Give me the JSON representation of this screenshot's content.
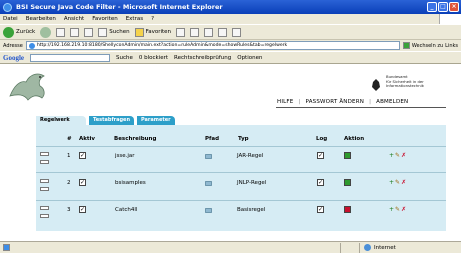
{
  "window": {
    "title": "BSI Secure Java Code Filter - Microsoft Internet Explorer"
  },
  "menu": [
    "Datei",
    "Bearbeiten",
    "Ansicht",
    "Favoriten",
    "Extras",
    "?"
  ],
  "toolbar": {
    "back": "Zurück",
    "search": "Suchen",
    "favorites": "Favoriten"
  },
  "address": {
    "label": "Adresse",
    "url": "http://192.168.219.10:8180/ShellyconAdmin/main.ext?action=ruleAdmin&mode=showRules&tab=regelwerk",
    "go": "Wechseln zu",
    "links": "Links"
  },
  "google": {
    "logo": "Google",
    "search": "Suche",
    "blocked": "0 blockiert",
    "spell": "Rechtschreibprüfung",
    "options": "Optionen"
  },
  "header": {
    "nav": [
      "HILFE",
      "PASSWORT ÄNDERN",
      "ABMELDEN"
    ],
    "bsi_lines": [
      "Bundesamt",
      "für Sicherheit in der",
      "Informationstechnik"
    ]
  },
  "tabs": [
    "Regelwerk",
    "Testabfragen",
    "Parameter"
  ],
  "table": {
    "headers": {
      "num": "#",
      "active": "Aktiv",
      "description": "Beschreibung",
      "path": "Pfad",
      "type": "Typ",
      "log": "Log",
      "action": "Aktion"
    },
    "rows": [
      {
        "num": "1",
        "description": "jsse.jar",
        "type": "JAR-Regel",
        "action_color": "#2e9a2e"
      },
      {
        "num": "2",
        "description": "bsisamples",
        "type": "JNLP-Regel",
        "action_color": "#2e9a2e"
      },
      {
        "num": "3",
        "description": "Catch4ll",
        "type": "Basisregel",
        "action_color": "#c8102e"
      }
    ]
  },
  "status": {
    "zone": "Internet"
  }
}
